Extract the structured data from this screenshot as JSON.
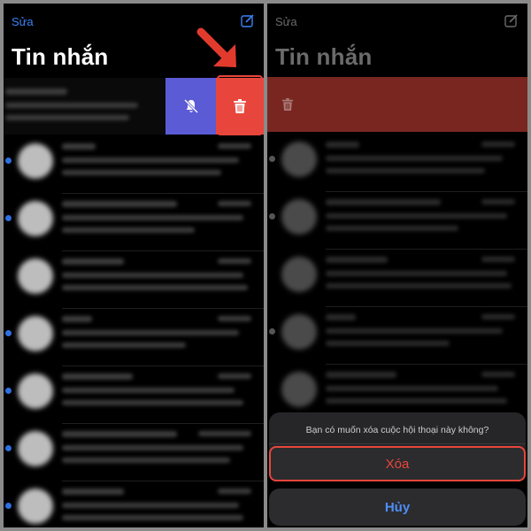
{
  "left": {
    "edit_label": "Sửa",
    "title": "Tin nhắn",
    "messages": [
      {
        "unread": true
      },
      {
        "unread": true
      },
      {
        "unread": false
      },
      {
        "unread": true
      },
      {
        "unread": true
      },
      {
        "unread": true
      },
      {
        "unread": true
      }
    ],
    "swipe_actions": {
      "mute_icon": "bell-slash-icon",
      "delete_icon": "trash-icon",
      "mute_color": "#5b5bd6",
      "delete_color": "#e8463c"
    }
  },
  "right": {
    "edit_label": "Sửa",
    "title": "Tin nhắn",
    "confirm": {
      "message": "Bạn có muốn xóa cuộc hội thoại này không?",
      "delete_label": "Xóa",
      "cancel_label": "Hủy"
    }
  },
  "colors": {
    "accent": "#3b82f6",
    "destructive": "#e8463c",
    "background": "#000000"
  }
}
